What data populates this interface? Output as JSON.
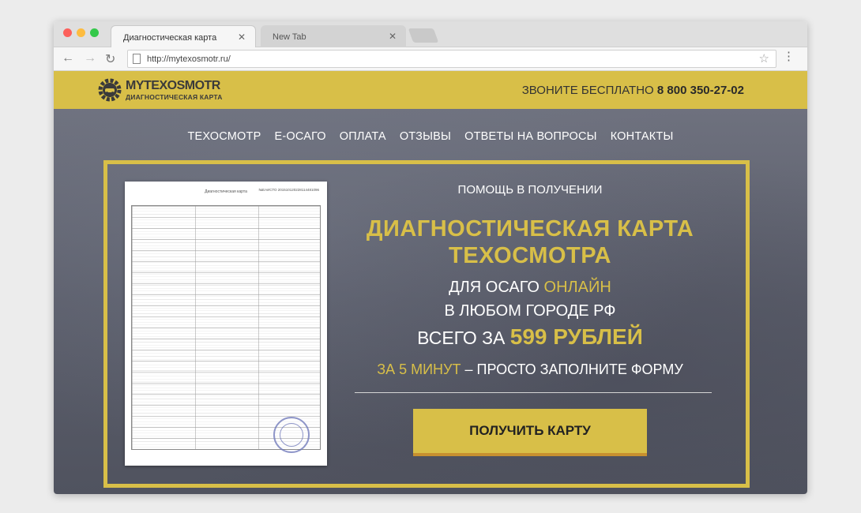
{
  "browser": {
    "tabs": [
      {
        "label": "Диагностическая карта",
        "close": "✕"
      },
      {
        "label": "New Tab",
        "close": "✕"
      }
    ],
    "url": "http://mytexosmotr.ru/"
  },
  "header": {
    "logo_title": "MYTEXOSMOTR",
    "logo_subtitle": "ДИАГНОСТИЧЕСКАЯ КАРТА",
    "phone_label": "ЗВОНИТЕ БЕСПЛАТНО",
    "phone_number": "8 800 350-27-02"
  },
  "nav": {
    "items": [
      "ТЕХОСМОТР",
      "Е-ОСАГО",
      "ОПЛАТА",
      "ОТЗЫВЫ",
      "ОТВЕТЫ НА ВОПРОСЫ",
      "КОНТАКТЫ"
    ]
  },
  "hero": {
    "pre_title": "ПОМОЩЬ В ПОЛУЧЕНИИ",
    "title_line1": "ДИАГНОСТИЧЕСКАЯ КАРТА",
    "title_line2": "ТЕХОСМОТРА",
    "line3_prefix": "ДЛЯ ОСАГО",
    "line3_highlight": "ОНЛАЙН",
    "line4": "В ЛЮБОМ ГОРОДЕ РФ",
    "price_prefix": "ВСЕГО ЗА",
    "price_highlight": "599 РУБЛЕЙ",
    "time_highlight": "ЗА 5 МИНУТ",
    "time_suffix": "– ПРОСТО ЗАПОЛНИТЕ ФОРМУ",
    "cta_label": "ПОЛУЧИТЬ КАРТУ"
  },
  "document": {
    "header": "Диагностическая карта",
    "number": "№ЕАИСТО 201510120228114481096"
  },
  "colors": {
    "accent": "#d8bf48",
    "button_shadow": "#c7902f",
    "hero_bg": "#5b5e6b"
  }
}
